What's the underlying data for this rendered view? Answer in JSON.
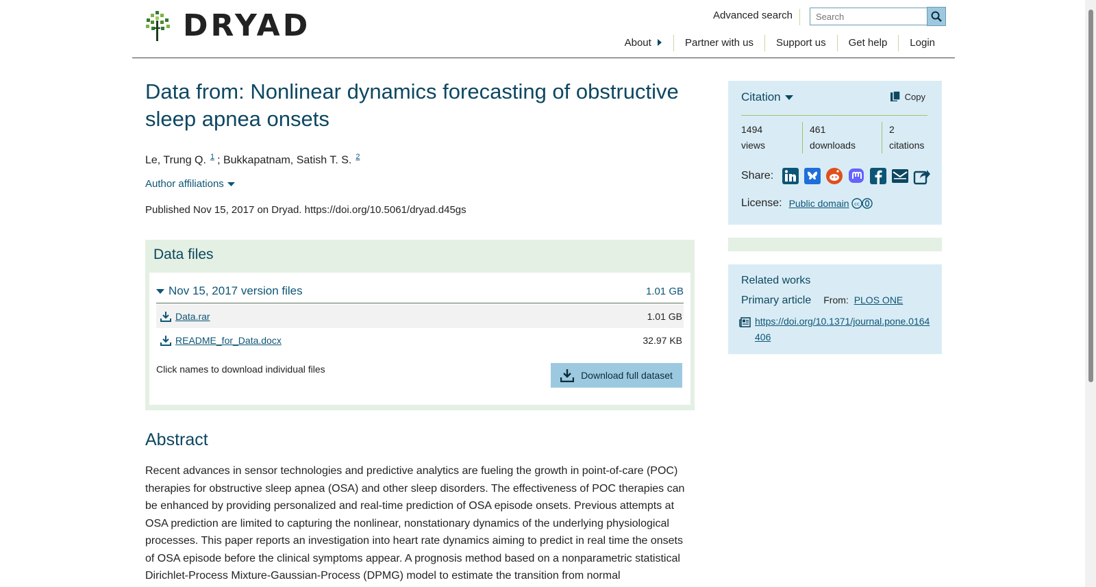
{
  "brand": {
    "name": "DRYAD"
  },
  "header": {
    "advanced_search": "Advanced search",
    "search_placeholder": "Search",
    "nav": [
      "About",
      "Partner with us",
      "Support us",
      "Get help",
      "Login"
    ]
  },
  "dataset": {
    "title": "Data from: Nonlinear dynamics forecasting of obstructive sleep apnea onsets",
    "authors": [
      {
        "name": "Le, Trung Q.",
        "sup": "1"
      },
      {
        "name": "Bukkapatnam, Satish T. S.",
        "sup": "2"
      }
    ],
    "author_sep": ";",
    "affiliations_toggle": "Author affiliations",
    "published": "Published Nov 15, 2017 on Dryad. https://doi.org/10.5061/dryad.d45gs"
  },
  "data_files": {
    "heading": "Data files",
    "version_label": "Nov 15, 2017 version files",
    "version_size": "1.01 GB",
    "files": [
      {
        "name": "Data.rar",
        "size": "1.01 GB"
      },
      {
        "name": "README_for_Data.docx",
        "size": "32.97 KB"
      }
    ],
    "note": "Click names to download individual files",
    "download_full": "Download full dataset"
  },
  "abstract": {
    "heading": "Abstract",
    "text": "Recent advances in sensor technologies and predictive analytics are fueling the growth in point-of-care (POC) therapies for obstructive sleep apnea (OSA) and other sleep disorders. The effectiveness of POC therapies can be enhanced by providing personalized and real-time prediction of OSA episode onsets. Previous attempts at OSA prediction are limited to capturing the nonlinear, nonstationary dynamics of the underlying physiological processes. This paper reports an investigation into heart rate dynamics aiming to predict in real time the onsets of OSA episode before the clinical symptoms appear. A prognosis method based on a nonparametric statistical Dirichlet-Process Mixture-Gaussian-Process (DPMG) model to estimate the transition from normal"
  },
  "sidebar": {
    "citation": {
      "toggle": "Citation",
      "copy": "Copy",
      "metrics": [
        {
          "value": "1494",
          "label": "views"
        },
        {
          "value": "461",
          "label": "downloads"
        },
        {
          "value": "2",
          "label": "citations"
        }
      ],
      "share_label": "Share:",
      "share_icons": [
        "linkedin-icon",
        "bluesky-icon",
        "reddit-icon",
        "mastodon-icon",
        "facebook-icon",
        "email-icon",
        "share-icon"
      ],
      "license_label": "License:",
      "license_value": "Public domain"
    },
    "related": {
      "heading": "Related works",
      "primary_label": "Primary article",
      "from_label": "From:",
      "from_value": "PLOS ONE",
      "link": "https://doi.org/10.1371/journal.pone.0164406"
    }
  },
  "colors": {
    "title": "#0d4761",
    "link": "#0d5576",
    "citation_bg": "#d9ecf5",
    "files_bg": "#e3f0e3",
    "button_bg": "#9cc9e0"
  }
}
